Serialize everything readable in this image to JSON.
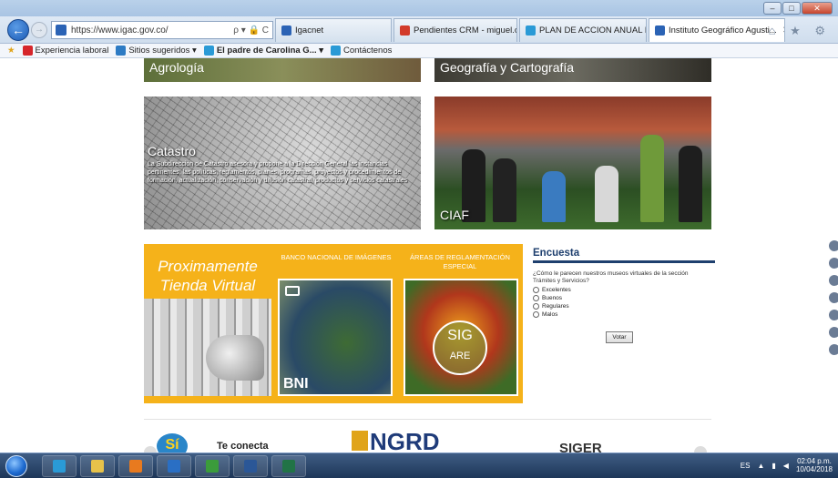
{
  "browser": {
    "url": "https://www.igac.gov.co/",
    "address_tools": "ρ ▾ 🔒 C",
    "tabs": [
      {
        "label": "Igacnet",
        "favicon_color": "#2b63b5"
      },
      {
        "label": "Pendientes CRM - miguel.colla...",
        "favicon_color": "#d23a2a"
      },
      {
        "label": "PLAN DE ACCION ANUAL IGA...",
        "favicon_color": "#2a9ad6"
      },
      {
        "label": "Instituto Geográfico Agusti...",
        "favicon_color": "#2b63b5",
        "active": true
      }
    ],
    "window_buttons": [
      "–",
      "□",
      "✕"
    ],
    "right_icons": "⌂ ★ ⚙"
  },
  "favorites_bar": {
    "items": [
      {
        "label": "Experiencia laboral",
        "icon_color": "#d6262b"
      },
      {
        "label": "Sitios sugeridos ▾",
        "icon_color": "#2d7bc4"
      },
      {
        "label": "El padre de Carolina G... ▾",
        "icon_color": "#2a9ad6"
      },
      {
        "label": "Contáctenos",
        "icon_color": "#2a9ad6"
      }
    ]
  },
  "page": {
    "banners": {
      "agrologia": "Agrología",
      "geografia": "Geografía y Cartografía"
    },
    "catastro": {
      "title": "Catastro",
      "description": "La Subdirección de Catastro asesora y propone a la Dirección General las instancias pertinentes, las políticas, reglamentos, planes, programas, proyectos y procedimientos de formación, actualización, conservación y difusión catastral, productos y servicios catastrales"
    },
    "ciaf": {
      "title": "CIAF"
    },
    "promo": {
      "tienda_line1": "Proximamente",
      "tienda_line2": "Tienda Virtual",
      "bni_header": "BANCO NACIONAL DE IMÁGENES",
      "bni_label": "BNI",
      "are_header": "ÁREAS DE REGLAMENTACIÓN ESPECIAL",
      "sig_line1": "SIG",
      "sig_line2": "ARE"
    },
    "poll": {
      "title": "Encuesta",
      "question": "¿Cómo le parecen nuestros museos virtuales de la sección Trámites y Servicios?",
      "options": [
        "Excelentes",
        "Buenos",
        "Regulares",
        "Malos"
      ],
      "vote_label": "Votar"
    },
    "footer": {
      "si_label": "Sí",
      "te_conecta": "Te conecta",
      "ngrd": "NGRD",
      "siger": "SIGER"
    }
  },
  "taskbar": {
    "apps": [
      {
        "name": "internet-explorer",
        "color": "#2a9ad6"
      },
      {
        "name": "file-explorer",
        "color": "#e7c24a"
      },
      {
        "name": "media-player",
        "color": "#e87a1f"
      },
      {
        "name": "outlook",
        "color": "#2a6fc4"
      },
      {
        "name": "lync",
        "color": "#3b9c3b"
      },
      {
        "name": "word",
        "color": "#2b5797"
      },
      {
        "name": "excel",
        "color": "#217346"
      }
    ],
    "language": "ES",
    "time": "02:04 p.m.",
    "date": "10/04/2018"
  }
}
